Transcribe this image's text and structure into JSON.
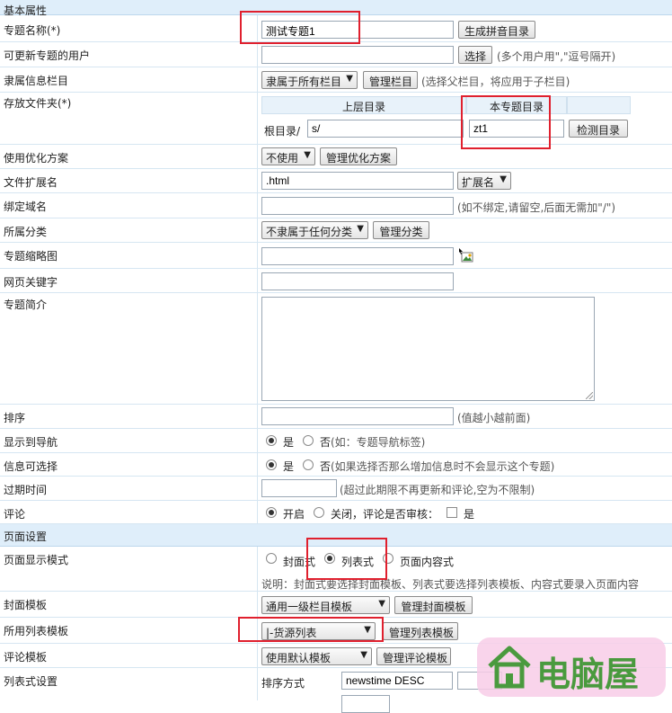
{
  "sections": {
    "basic": "基本属性",
    "page": "页面设置"
  },
  "fields": {
    "topic_name": {
      "label": "专题名称(*)",
      "value": "测试专题1",
      "button": "生成拼音目录"
    },
    "update_users": {
      "label": "可更新专题的用户",
      "value": "",
      "button": "选择",
      "hint": "(多个用户用\",\"逗号隔开)"
    },
    "column": {
      "label": "隶属信息栏目",
      "select": "隶属于所有栏目",
      "button": "管理栏目",
      "hint": "(选择父栏目，将应用于子栏目)"
    },
    "folder": {
      "label": "存放文件夹(*)",
      "col_parent": "上层目录",
      "col_self": "本专题目录",
      "root_label": "根目录/",
      "parent_value": "s/",
      "self_value": "zt1",
      "button": "检测目录"
    },
    "optimize": {
      "label": "使用优化方案",
      "select": "不使用",
      "button": "管理优化方案"
    },
    "extension": {
      "label": "文件扩展名",
      "value": ".html",
      "select": "扩展名"
    },
    "domain": {
      "label": "绑定域名",
      "value": "",
      "hint": "(如不绑定,请留空,后面无需加\"/\")"
    },
    "category": {
      "label": "所属分类",
      "select": "不隶属于任何分类",
      "button": "管理分类"
    },
    "thumbnail": {
      "label": "专题缩略图",
      "value": ""
    },
    "keywords": {
      "label": "网页关键字",
      "value": ""
    },
    "intro": {
      "label": "专题简介",
      "value": ""
    },
    "order": {
      "label": "排序",
      "value": "",
      "hint": "(值越小越前面)"
    },
    "nav": {
      "label": "显示到导航",
      "opt_yes": "是",
      "opt_no": "否",
      "hint": "(如：专题导航标签)"
    },
    "selectable": {
      "label": "信息可选择",
      "opt_yes": "是",
      "opt_no": "否",
      "hint": "(如果选择否那么增加信息时不会显示这个专题)"
    },
    "expire": {
      "label": "过期时间",
      "value": "",
      "hint": "(超过此期限不再更新和评论,空为不限制)"
    },
    "comment": {
      "label": "评论",
      "opt_on": "开启",
      "opt_off": "关闭，评论是否审核：",
      "opt_review": "是"
    },
    "display_mode": {
      "label": "页面显示模式",
      "opt_cover": "封面式",
      "opt_list": "列表式",
      "opt_content": "页面内容式",
      "note": "说明：封面式要选择封面模板、列表式要选择列表模板、内容式要录入页面内容"
    },
    "cover_tpl": {
      "label": "封面模板",
      "select": "通用一级栏目模板",
      "button": "管理封面模板"
    },
    "list_tpl": {
      "label": "所用列表模板",
      "select": "|-货源列表",
      "button": "管理列表模板"
    },
    "comment_tpl": {
      "label": "评论模板",
      "select": "使用默认模板",
      "button": "管理评论模板"
    },
    "list_settings": {
      "label": "列表式设置",
      "sort_label": "排序方式",
      "sort_value": "newstime DESC"
    }
  },
  "watermark": {
    "text": "电脑屋"
  }
}
